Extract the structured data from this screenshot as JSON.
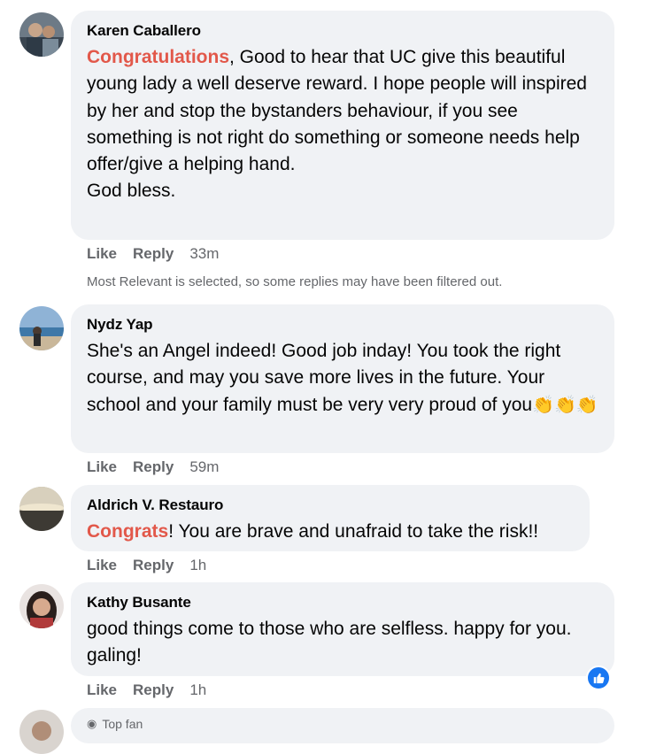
{
  "comments": [
    {
      "author": "Karen Caballero",
      "tag": "Congratulations",
      "text": ", Good to hear that UC give this beautiful young lady a well deserve reward. I hope people will inspired by her and stop the bystanders behaviour, if you see something is not right do something or someone needs help offer/give a helping hand.",
      "text2": "God bless.",
      "like": "Like",
      "reply": "Reply",
      "time": "33m"
    },
    {
      "author": "Nydz Yap",
      "text": "She's an Angel indeed! Good job inday! You took the right course, and may you save more lives in the future. Your school and your family must be very very proud of you",
      "emoji": "👏👏👏",
      "like": "Like",
      "reply": "Reply",
      "time": "59m"
    },
    {
      "author": "Aldrich V. Restauro",
      "tag": "Congrats",
      "text": "! You are brave and unafraid to take the risk!!",
      "like": "Like",
      "reply": "Reply",
      "time": "1h"
    },
    {
      "author": "Kathy Busante",
      "text": "good things come to those who are selfless. happy for you. galing!",
      "like": "Like",
      "reply": "Reply",
      "time": "1h"
    }
  ],
  "filter_note": "Most Relevant is selected, so some replies may have been filtered out.",
  "partial": {
    "badge": "Top fan"
  },
  "colors": {
    "tag": "#e2584a",
    "bubble": "#f0f2f5",
    "meta": "#65676b",
    "like_blue": "#1877f2"
  }
}
